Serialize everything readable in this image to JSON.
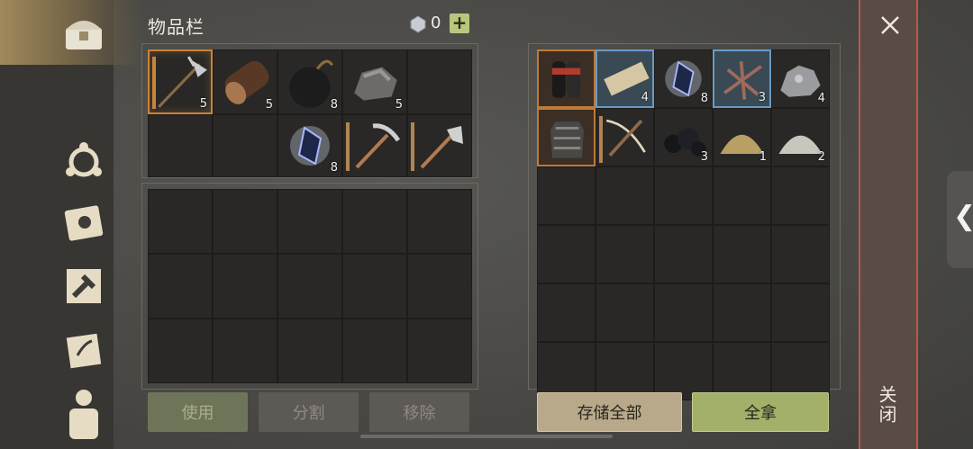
{
  "inventory": {
    "title": "物品栏",
    "currency_count": "0",
    "plus_label": "+",
    "slots_row1": [
      {
        "icon": "halberd-icon",
        "count": "5"
      },
      {
        "icon": "log-icon",
        "count": "5"
      },
      {
        "icon": "bomb-icon",
        "count": "8"
      },
      {
        "icon": "stone-icon",
        "count": "5"
      },
      {
        "icon": "",
        "count": ""
      }
    ],
    "slots_row2": [
      {
        "icon": "",
        "count": ""
      },
      {
        "icon": "",
        "count": ""
      },
      {
        "icon": "crystal-icon",
        "count": "8"
      },
      {
        "icon": "pickaxe-icon",
        "count": ""
      },
      {
        "icon": "axe-icon",
        "count": ""
      }
    ],
    "buttons": {
      "use": "使用",
      "split": "分割",
      "remove": "移除"
    }
  },
  "storage": {
    "slots_row1": [
      {
        "icon": "gauntlet-icon",
        "count": ""
      },
      {
        "icon": "plank-icon",
        "count": "4"
      },
      {
        "icon": "crystal-icon",
        "count": "8"
      },
      {
        "icon": "twine-bundle-icon",
        "count": "3"
      },
      {
        "icon": "iron-ore-icon",
        "count": "4"
      }
    ],
    "slots_row2": [
      {
        "icon": "armor-icon",
        "count": ""
      },
      {
        "icon": "crossbow-icon",
        "count": ""
      },
      {
        "icon": "coal-icon",
        "count": "3"
      },
      {
        "icon": "sand-pile-icon",
        "count": "1"
      },
      {
        "icon": "powder-pile-icon",
        "count": "2"
      }
    ],
    "buttons": {
      "store_all": "存储全部",
      "take_all": "全拿"
    }
  },
  "close_label": "关闭",
  "colors": {
    "accent": "#c9833c",
    "take_all": "#a3b06a",
    "close_border": "#b85a4c"
  }
}
